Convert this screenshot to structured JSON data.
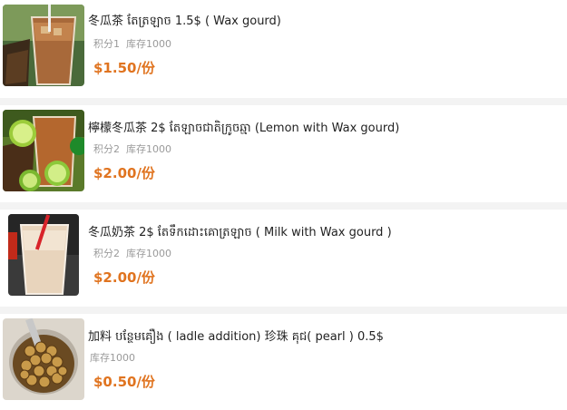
{
  "accent_color": "#e07420",
  "products": [
    {
      "image_icon": "iced-tea-image",
      "title": "冬瓜茶 តែត្រឡាច 1.5$ ( Wax gourd)",
      "points": "积分1",
      "stock": "库存1000",
      "price": "$1.50/份"
    },
    {
      "image_icon": "lemon-tea-image",
      "title": "檸檬冬瓜茶 2$ តែឡាចជាតិក្រូចឆ្មា (Lemon with Wax gourd)",
      "points": "积分2",
      "stock": "库存1000",
      "price": "$2.00/份"
    },
    {
      "image_icon": "milk-tea-image",
      "title": "冬瓜奶茶 2$ តែទឹកដោះគោត្រឡាច ( Milk with Wax gourd )",
      "points": "积分2",
      "stock": "库存1000",
      "price": "$2.00/份"
    },
    {
      "image_icon": "pearl-topping-image",
      "title": "加料 បន្ថែមគឿង ( ladle addition) 珍珠 គុជ( pearl ) 0.5$",
      "stock": "库存1000",
      "price": "$0.50/份"
    }
  ]
}
